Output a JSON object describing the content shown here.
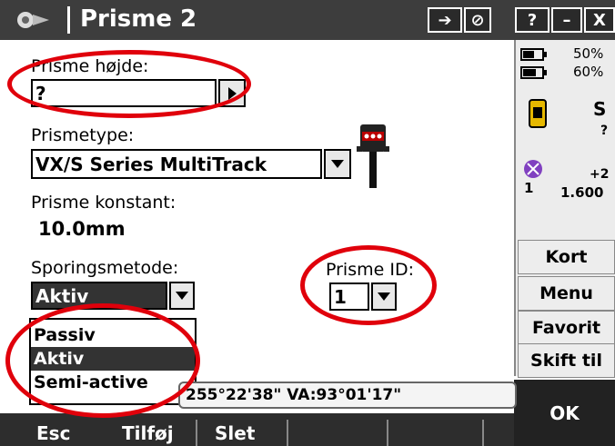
{
  "window": {
    "title": "Prisme 2",
    "btn_arrow": "➔",
    "btn_slash": "⊘",
    "btn_help": "?",
    "btn_min": "–",
    "btn_close": "X"
  },
  "form": {
    "height_label": "Prisme højde:",
    "height_value": "?",
    "type_label": "Prismetype:",
    "type_value": "VX/S Series MultiTrack",
    "constant_label": "Prisme konstant:",
    "constant_value": "10.0mm",
    "tracking_label": "Sporingsmetode:",
    "tracking_value": "Aktiv",
    "tracking_options": [
      "Passiv",
      "Aktiv",
      "Semi-active"
    ],
    "prism_id_label": "Prisme ID:",
    "prism_id_value": "1"
  },
  "status_panel": {
    "battery1": "50%",
    "battery2": "60%",
    "instrument_letter": "S",
    "instrument_value": "?",
    "target_value1": "+2",
    "target_num": "1",
    "target_value2": "1.600"
  },
  "side_buttons": [
    "Kort",
    "Menu",
    "Favorit",
    "Skift til"
  ],
  "ok_label": "OK",
  "status_line": "255°22'38\"  VA:93°01'17\"",
  "softkeys": [
    "Esc",
    "Tilføj",
    "Slet"
  ]
}
